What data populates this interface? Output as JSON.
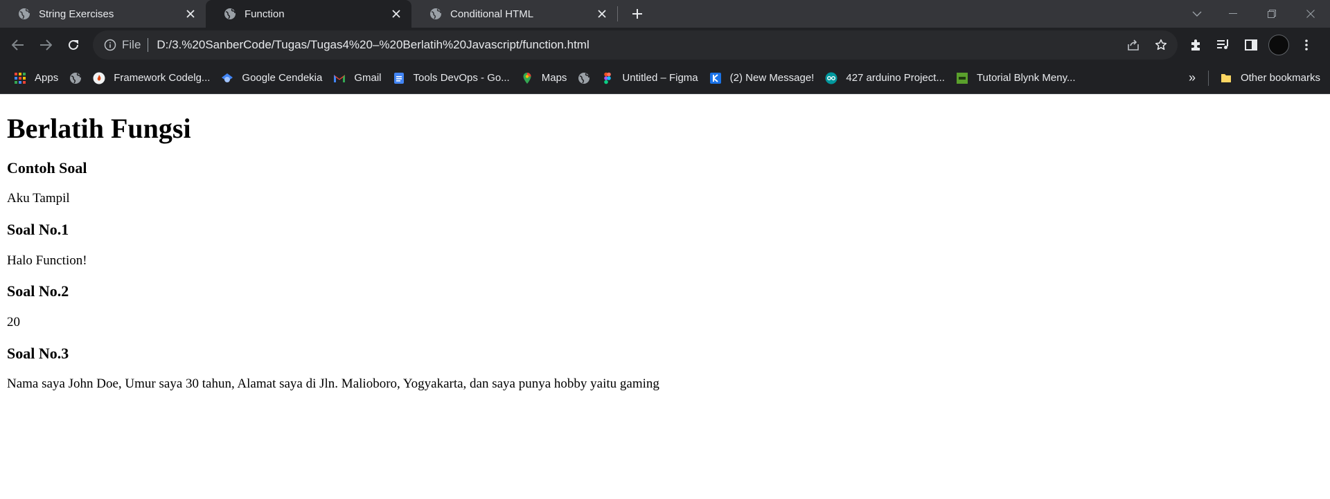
{
  "browser": {
    "tabs": [
      {
        "title": "String Exercises",
        "favicon": "globe-icon",
        "active": false
      },
      {
        "title": "Function",
        "favicon": "globe-icon",
        "active": true
      },
      {
        "title": "Conditional HTML",
        "favicon": "globe-icon",
        "active": false
      }
    ],
    "omnibox": {
      "scheme": "File",
      "url": "D:/3.%20SanberCode/Tugas/Tugas4%20–%20Berlatih%20Javascript/function.html"
    },
    "bookmarks": [
      {
        "label": "Apps",
        "icon": "apps-grid-icon"
      },
      {
        "label": "",
        "icon": "globe-icon"
      },
      {
        "label": "Framework Codelg...",
        "icon": "codelgniter-icon"
      },
      {
        "label": "Google Cendekia",
        "icon": "scholar-icon"
      },
      {
        "label": "Gmail",
        "icon": "gmail-icon"
      },
      {
        "label": "Tools DevOps - Go...",
        "icon": "docs-icon"
      },
      {
        "label": "Maps",
        "icon": "maps-pin-icon"
      },
      {
        "label": "",
        "icon": "globe-icon"
      },
      {
        "label": "Untitled – Figma",
        "icon": "figma-icon"
      },
      {
        "label": "(2) New Message!",
        "icon": "message-icon"
      },
      {
        "label": "427 arduino Project...",
        "icon": "arduino-icon"
      },
      {
        "label": "Tutorial Blynk Meny...",
        "icon": "iot-icon"
      }
    ],
    "more_bookmarks": "»",
    "other_bookmarks": "Other bookmarks"
  },
  "page": {
    "heading": "Berlatih Fungsi",
    "sections": [
      {
        "title": "Contoh Soal",
        "output": "Aku Tampil"
      },
      {
        "title": "Soal No.1",
        "output": "Halo Function!"
      },
      {
        "title": "Soal No.2",
        "output": "20"
      },
      {
        "title": "Soal No.3",
        "output": "Nama saya John Doe, Umur saya 30 tahun, Alamat saya di Jln. Malioboro, Yogyakarta, dan saya punya hobby yaitu gaming"
      }
    ]
  },
  "colors": {
    "tabstrip": "#35363a",
    "toolbar": "#202124",
    "omnibox": "#292a2d",
    "text": "#e8eaed"
  }
}
